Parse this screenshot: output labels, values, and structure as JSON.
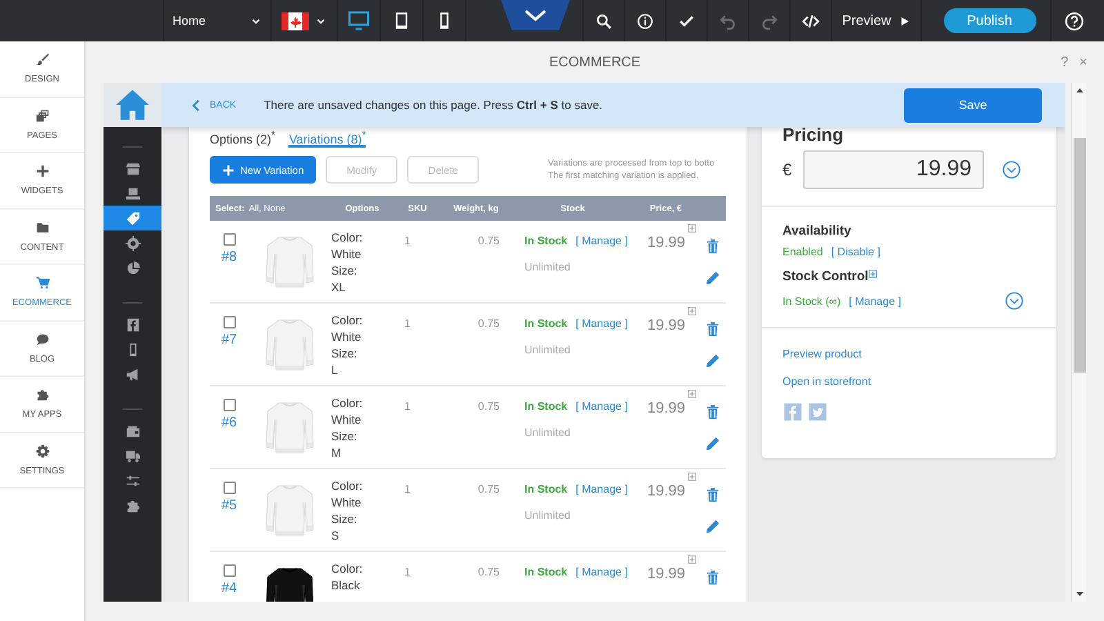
{
  "toolbar": {
    "page_select": "Home",
    "devices": [
      {
        "selected": true
      },
      {
        "selected": false
      },
      {
        "selected": false
      }
    ],
    "actions": [
      {
        "disabled": false
      },
      {
        "disabled": false
      },
      {
        "disabled": false
      },
      {
        "disabled": true
      },
      {
        "disabled": true
      },
      {
        "disabled": false
      }
    ],
    "preview": "Preview",
    "publish": "Publish"
  },
  "sidebar": {
    "items": [
      {
        "label": "DESIGN",
        "selected": false
      },
      {
        "label": "PAGES",
        "selected": false
      },
      {
        "label": "WIDGETS",
        "selected": false
      },
      {
        "label": "CONTENT",
        "selected": false
      },
      {
        "label": "ECOMMERCE",
        "selected": true
      },
      {
        "label": "BLOG",
        "selected": false
      },
      {
        "label": "MY APPS",
        "selected": false
      },
      {
        "label": "SETTINGS",
        "selected": false
      }
    ]
  },
  "panel": {
    "title": "ECOMMERCE",
    "help": "?",
    "close": "×"
  },
  "banner": {
    "back": "BACK",
    "message": "There are unsaved changes on this page. Press **Ctrl + S** to save.",
    "save": "Save"
  },
  "icon_strip": {
    "groups": [
      {
        "items": [
          {
            "selected": false
          },
          {
            "selected": false
          },
          {
            "selected": true
          },
          {
            "selected": false
          },
          {
            "selected": false
          }
        ]
      },
      {
        "items": [
          {
            "selected": false
          },
          {
            "selected": false
          },
          {
            "selected": false
          }
        ]
      },
      {
        "items": [
          {
            "selected": false
          },
          {
            "selected": false
          },
          {
            "selected": false
          },
          {
            "selected": false
          }
        ]
      }
    ]
  },
  "tabs": [
    {
      "label": "Options (2)$^{*}$",
      "selected": false
    },
    {
      "label": "Variations (8)$^{*}$",
      "selected": true
    }
  ],
  "buttons": [
    {
      "label": "New Variation",
      "kind": "primary",
      "disabled": false
    },
    {
      "label": "Modify",
      "kind": "plain",
      "disabled": true
    },
    {
      "label": "Delete",
      "kind": "plain",
      "disabled": true
    }
  ],
  "note": [
    "Variations are processed from top to botto",
    "The first matching variation is applied."
  ],
  "table": {
    "select_label": "Select:",
    "select_links": "All, None",
    "columns": [
      "Options",
      "SKU",
      "Weight, kg",
      "Stock",
      "Price, €"
    ],
    "rows": [
      {
        "number": "#8",
        "checked": false,
        "options": "Color: White Size: XL",
        "sku": "1",
        "weight": "0.75",
        "stock": "In Stock",
        "manage": "[ Manage ]",
        "quantity": "Unlimited",
        "price": "19.99"
      },
      {
        "number": "#7",
        "checked": false,
        "options": "Color: White Size: L",
        "sku": "1",
        "weight": "0.75",
        "stock": "In Stock",
        "manage": "[ Manage ]",
        "quantity": "Unlimited",
        "price": "19.99"
      },
      {
        "number": "#6",
        "checked": false,
        "options": "Color: White Size: M",
        "sku": "1",
        "weight": "0.75",
        "stock": "In Stock",
        "manage": "[ Manage ]",
        "quantity": "Unlimited",
        "price": "19.99"
      },
      {
        "number": "#5",
        "checked": false,
        "options": "Color: White Size: S",
        "sku": "1",
        "weight": "0.75",
        "stock": "In Stock",
        "manage": "[ Manage ]",
        "quantity": "Unlimited",
        "price": "19.99"
      },
      {
        "number": "#4",
        "checked": false,
        "options": "Color: Black",
        "sku": "1",
        "weight": "0.75",
        "stock": "In Stock",
        "manage": "[ Manage ]",
        "price": "19.99"
      }
    ]
  },
  "pricing": {
    "title": "Pricing",
    "currency": "€",
    "value": "19.99"
  },
  "availability": {
    "title": "Availability",
    "status": "Enabled",
    "action": "[ Disable ]"
  },
  "stock_control": {
    "title": "Stock Control",
    "status": "In Stock (∞)",
    "action": "[ Manage ]"
  },
  "links": [
    "Preview product",
    "Open in storefront"
  ]
}
